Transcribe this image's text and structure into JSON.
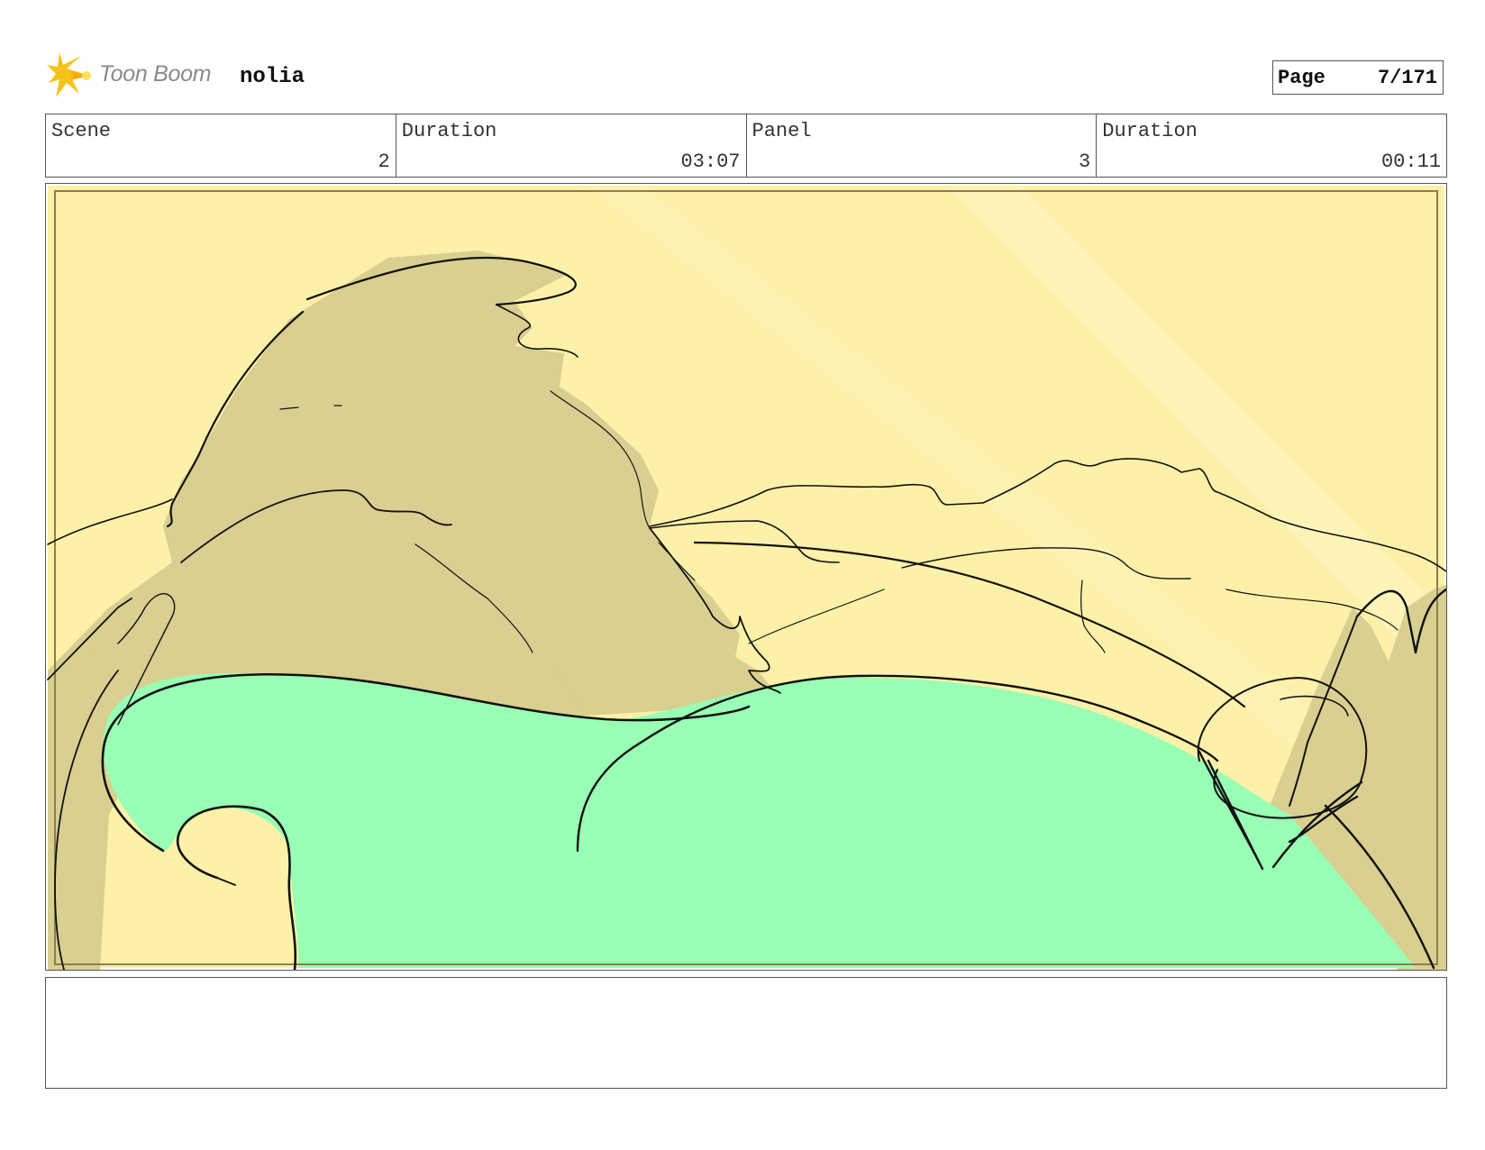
{
  "header": {
    "logo_text": "Toon Boom",
    "project_name": "nolia",
    "page_label": "Page",
    "page_value": "7/171"
  },
  "info": {
    "scene_label": "Scene",
    "scene_value": "2",
    "scene_duration_label": "Duration",
    "scene_duration_value": "03:07",
    "panel_label": "Panel",
    "panel_value": "3",
    "panel_duration_label": "Duration",
    "panel_duration_value": "00:11"
  },
  "panel": {
    "sky_color": "#fdf0a8",
    "rock_color": "#d8cf90",
    "grass_color": "#98ffb4",
    "line_color": "#111111"
  },
  "notes": {
    "text": ""
  }
}
